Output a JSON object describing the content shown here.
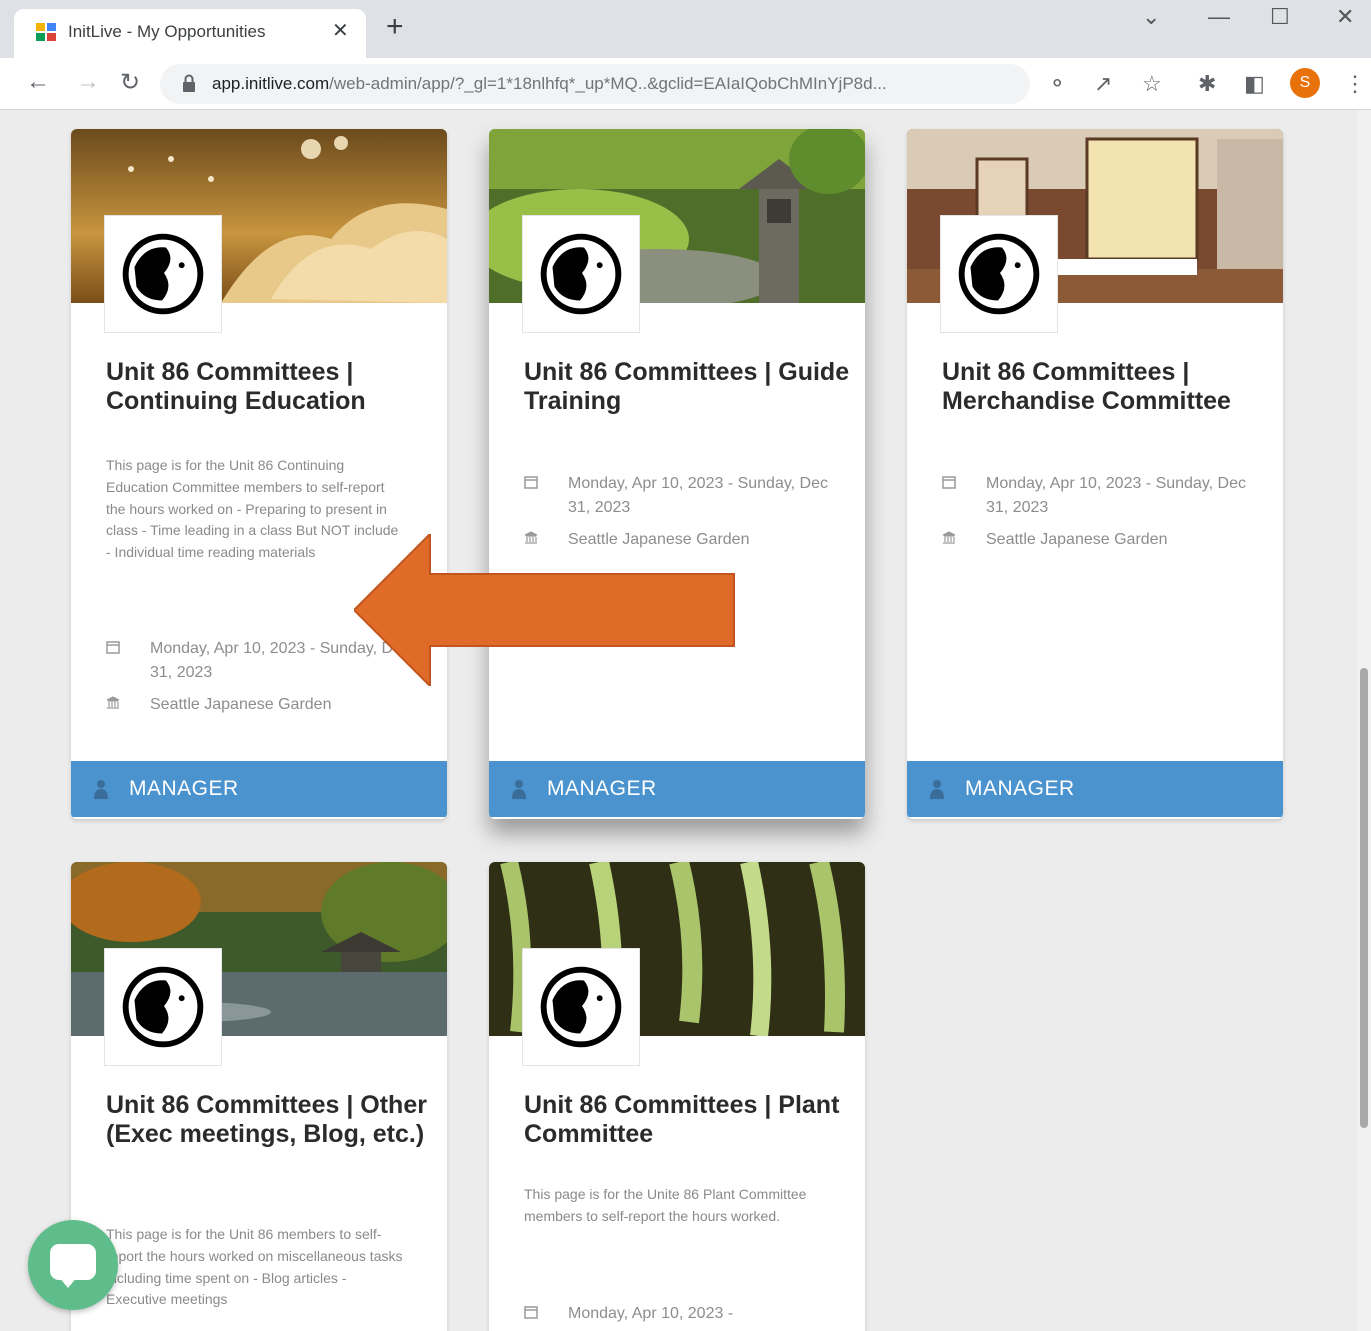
{
  "browser": {
    "tab_title": "InitLive - My Opportunities",
    "tab_close": "✕",
    "new_tab": "+",
    "url_host": "app.initlive.com",
    "url_path": "/web-admin/app/?_gl=1*18nlhfq*_up*MQ..&gclid=EAIaIQobChMInYjP8d...",
    "profile_initial": "S",
    "window_controls": [
      "⌄",
      "—",
      "☐",
      "✕"
    ]
  },
  "cards": [
    {
      "title": "Unit 86 Committees | Continuing Education",
      "description": "This page is for the Unit 86 Continuing Education Committee members to self-report the hours worked on - Preparing to present in class - Time leading in a class But NOT include - Individual time reading materials",
      "dates": "Monday, Apr 10, 2023 - Sunday, Dec 31, 2023",
      "location": "Seattle Japanese Garden",
      "role": "MANAGER",
      "image_subject": "open book with birds"
    },
    {
      "title": "Unit 86 Committees | Guide Training",
      "description": "",
      "dates": "Monday, Apr 10, 2023 - Sunday, Dec 31, 2023",
      "location": "Seattle Japanese Garden",
      "role": "MANAGER",
      "image_subject": "garden with stone lantern"
    },
    {
      "title": "Unit 86 Committees | Merchandise Committee",
      "description": "",
      "dates": "Monday, Apr 10, 2023 - Sunday, Dec 31, 2023",
      "location": "Seattle Japanese Garden",
      "role": "MANAGER",
      "image_subject": "gift shop display"
    },
    {
      "title": "Unit 86 Committees | Other (Exec meetings, Blog, etc.)",
      "description": "This page is for the Unit 86 members to self-report the hours worked on miscellaneous tasks including time spent on - Blog articles - Executive meetings",
      "image_subject": "garden pond with pagoda"
    },
    {
      "title": "Unit 86 Committees | Plant Committee",
      "description": "This page is for the Unite 86 Plant Committee members to self-report the hours worked.",
      "dates_start": "Monday, Apr 10, 2023 -",
      "image_subject": "hanging green plant"
    }
  ],
  "colors": {
    "footer_blue": "#4b93cf",
    "arrow_orange": "#e06a28",
    "chat_green": "#5ebd8a"
  },
  "icons": {
    "date": "calendar-icon",
    "location": "building-icon",
    "role": "person-icon",
    "chat": "chat-icon"
  }
}
